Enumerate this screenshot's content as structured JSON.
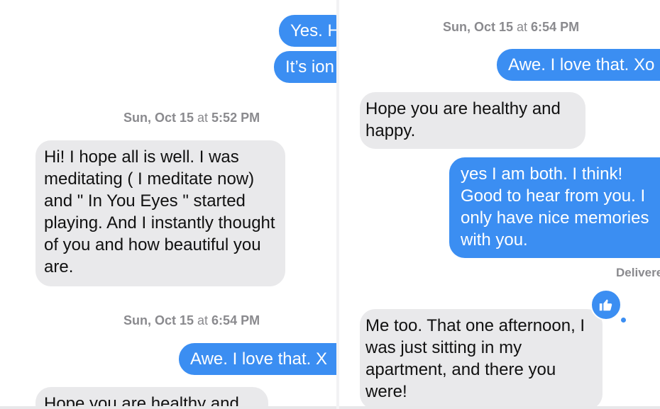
{
  "left_panel": {
    "sent_top_1": "Yes. H",
    "sent_top_2": "It’s ion",
    "timestamp_1": {
      "day": "Sun, Oct 15",
      "mid": " at ",
      "time": "5:52 PM"
    },
    "received_long": "Hi! I hope all is well. I was meditating ( I meditate now) and \" In You Eyes \" started playing. And I instantly thought of you and how beautiful you are.",
    "timestamp_2": {
      "day": "Sun, Oct 15",
      "mid": " at ",
      "time": "6:54 PM"
    },
    "sent_awe": "Awe. I love that. X",
    "received_cut": "Hope you are healthy and"
  },
  "right_panel": {
    "timestamp": {
      "day": "Sun, Oct 15",
      "mid": " at ",
      "time": "6:54 PM"
    },
    "sent_awe": "Awe. I love that. Xo",
    "received_hope": "Hope you are healthy and happy.",
    "sent_yes": "yes  I am both. I think! Good to hear from you. I only have nice memories with you.",
    "delivered": "Delivere",
    "tapback_icon": "thumbs-up-icon",
    "received_me_too": "Me too. That one afternoon, I was just sitting in my apartment, and there you were!"
  },
  "colors": {
    "sent": "#3b8ef2",
    "received": "#e9e9eb",
    "meta": "#8a8a8e"
  }
}
